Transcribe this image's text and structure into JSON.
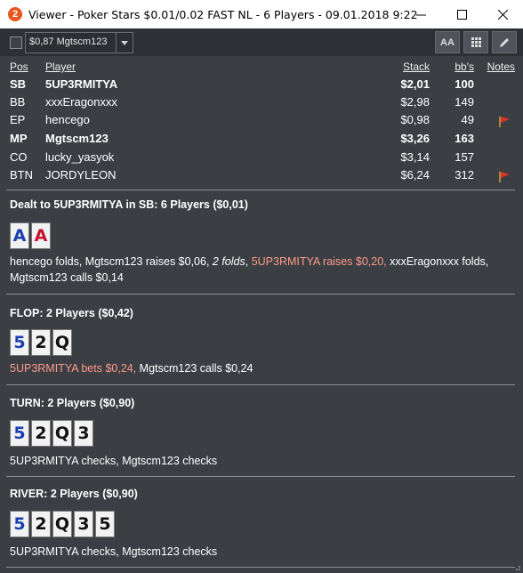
{
  "window": {
    "app_icon_glyph": "2",
    "title": "Viewer - Poker Stars $0.01/0.02 FAST NL - 6 Players - 09.01.2018 9:22"
  },
  "toolbar": {
    "combo_value": "$0,87 Mgtscm123",
    "font_button_label": "AA"
  },
  "table": {
    "headers": {
      "pos": "Pos",
      "player": "Player",
      "stack": "Stack",
      "bbs": "bb's",
      "notes": "Notes"
    },
    "rows": [
      {
        "pos": "SB",
        "player": "5UP3RMITYA",
        "stack": "$2,01",
        "bbs": "100",
        "bold": true,
        "flag": false
      },
      {
        "pos": "BB",
        "player": "xxxEragonxxx",
        "stack": "$2,98",
        "bbs": "149",
        "bold": false,
        "flag": false
      },
      {
        "pos": "EP",
        "player": "hencego",
        "stack": "$0,98",
        "bbs": "49",
        "bold": false,
        "flag": true
      },
      {
        "pos": "MP",
        "player": "Mgtscm123",
        "stack": "$3,26",
        "bbs": "163",
        "bold": true,
        "flag": false
      },
      {
        "pos": "CO",
        "player": "lucky_yasyok",
        "stack": "$3,14",
        "bbs": "157",
        "bold": false,
        "flag": false
      },
      {
        "pos": "BTN",
        "player": "JORDYLEON",
        "stack": "$6,24",
        "bbs": "312",
        "bold": false,
        "flag": true
      }
    ]
  },
  "preflop": {
    "title": "Dealt to 5UP3RMITYA in SB: 6 Players ($0,01)",
    "cards": [
      "A",
      "A"
    ],
    "actions": {
      "a1": "hencego folds, Mgtscm123 raises $0,06, ",
      "a2": "2 folds",
      "a3": ", ",
      "a4": "5UP3RMITYA raises $0,20,",
      "a5": " xxxEragonxxx folds, Mgtscm123 calls $0,14"
    }
  },
  "flop": {
    "title": "FLOP: 2 Players ($0,42)",
    "cards": [
      "5",
      "2",
      "Q"
    ],
    "actions": {
      "hero": "5UP3RMITYA bets $0,24,",
      "rest": " Mgtscm123 calls $0,24"
    }
  },
  "turn": {
    "title": "TURN: 2 Players ($0,90)",
    "cards": [
      "5",
      "2",
      "Q",
      "3"
    ],
    "actions": "5UP3RMITYA checks, Mgtscm123 checks"
  },
  "river": {
    "title": "RIVER: 2 Players ($0,90)",
    "cards": [
      "5",
      "2",
      "Q",
      "3",
      "5"
    ],
    "actions": "5UP3RMITYA checks, Mgtscm123 checks"
  },
  "colors": {
    "background": "#3b3f44",
    "hero_action": "#ff9a8a",
    "red_suit": "#c8102e",
    "blue_suit": "#1a3fb0",
    "flag": "#d9342b"
  }
}
